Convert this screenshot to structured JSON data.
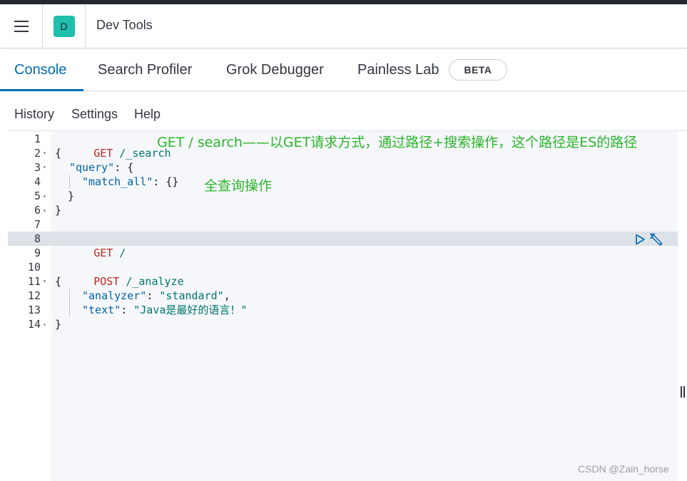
{
  "header": {
    "menu_icon": "hamburger-icon",
    "space_initial": "D",
    "app_title": "Dev Tools"
  },
  "tabs": [
    {
      "label": "Console",
      "active": true
    },
    {
      "label": "Search Profiler",
      "active": false
    },
    {
      "label": "Grok Debugger",
      "active": false
    },
    {
      "label": "Painless Lab",
      "active": false
    }
  ],
  "beta_badge": "BETA",
  "toolbar": {
    "history": "History",
    "settings": "Settings",
    "help": "Help"
  },
  "editor": {
    "lines": [
      {
        "n": "1",
        "fold": "",
        "method": "GET",
        "path": " /_search"
      },
      {
        "n": "2",
        "fold": "▾",
        "text": "{"
      },
      {
        "n": "3",
        "fold": "▾",
        "key": "\"query\"",
        "rest": ": {"
      },
      {
        "n": "4",
        "fold": "",
        "key": "\"match_all\"",
        "rest": ": {}"
      },
      {
        "n": "5",
        "fold": "▴",
        "text": "  }"
      },
      {
        "n": "6",
        "fold": "▴",
        "text": "}"
      },
      {
        "n": "7",
        "fold": "",
        "text": ""
      },
      {
        "n": "8",
        "fold": "",
        "method": "GET",
        "path": " /"
      },
      {
        "n": "9",
        "fold": "",
        "text": ""
      },
      {
        "n": "10",
        "fold": "",
        "method": "POST",
        "path": " /_analyze"
      },
      {
        "n": "11",
        "fold": "▾",
        "text": "{"
      },
      {
        "n": "12",
        "fold": "",
        "key": "\"analyzer\"",
        "rest": ": ",
        "value": "\"standard\"",
        "tail": ","
      },
      {
        "n": "13",
        "fold": "",
        "key": "\"text\"",
        "rest": ": ",
        "value": "\"Java是最好的语言！\""
      },
      {
        "n": "14",
        "fold": "▴",
        "text": "}"
      }
    ],
    "highlighted_line": "8",
    "annotations": {
      "line1": "GET / search——以GET请求方式，通过路径+搜索操作，这个路径是ES的路径",
      "line4": "全查询操作"
    },
    "run_icon": "play-icon",
    "settings_icon": "wrench-icon"
  },
  "watermark": "CSDN @Zain_horse",
  "colors": {
    "accent": "#006bb4",
    "space_avatar": "#1ebfae",
    "method": "#bd271e",
    "annotation": "#2ab52a"
  }
}
